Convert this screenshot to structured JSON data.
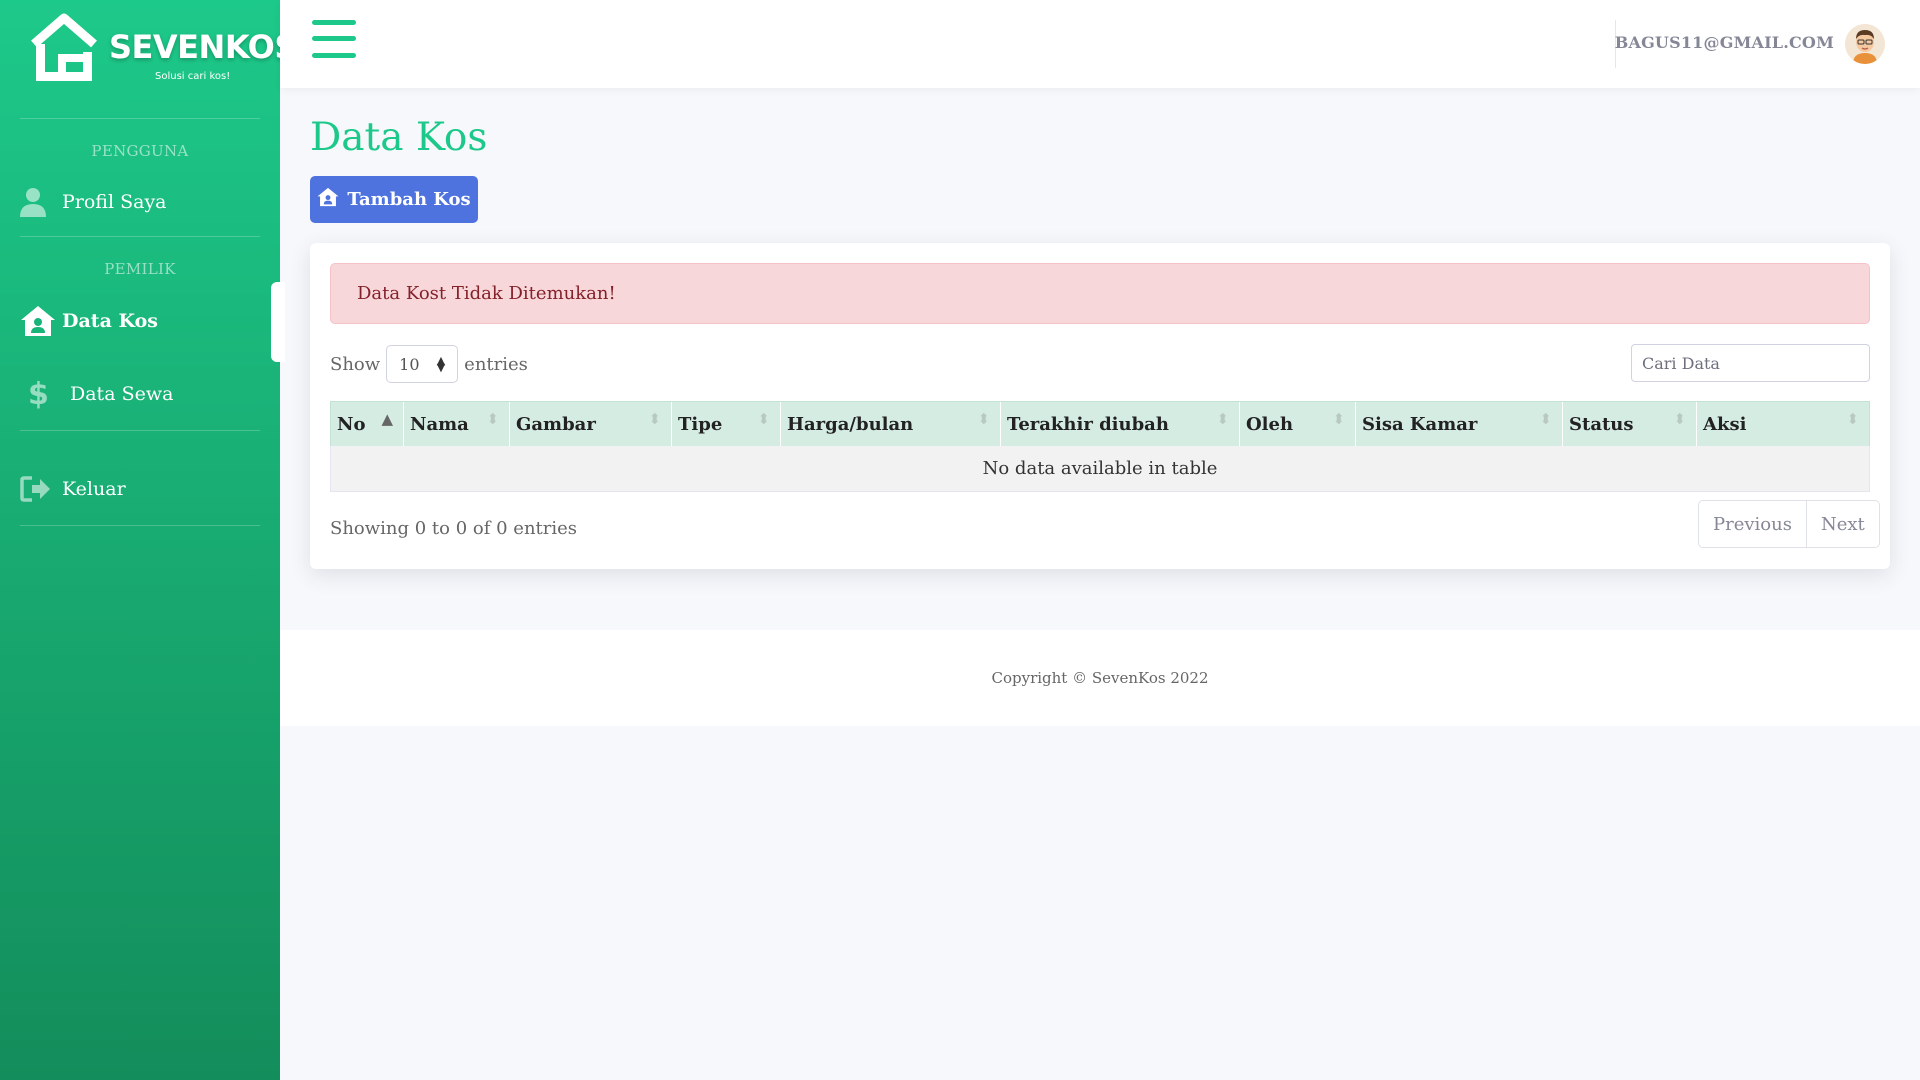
{
  "brand": {
    "name": "SEVENKOS",
    "tagline": "Solusi cari kos!"
  },
  "sidebar": {
    "sections": [
      {
        "heading": "PENGGUNA"
      },
      {
        "heading": "PEMILIK"
      }
    ],
    "items": [
      {
        "label": "Profil Saya",
        "icon": "user-icon"
      },
      {
        "label": "Data Kos",
        "icon": "house-user-icon",
        "active": true
      },
      {
        "label": "Data Sewa",
        "icon": "dollar-icon"
      },
      {
        "label": "Keluar",
        "icon": "sign-out-icon"
      }
    ]
  },
  "topbar": {
    "menu_icon": "hamburger-icon",
    "user_email": "BAGUS11@GMAIL.COM",
    "avatar_icon": "user-avatar"
  },
  "page": {
    "title": "Data Kos",
    "add_button": "Tambah Kos"
  },
  "alert": {
    "message": "Data Kost Tidak Ditemukan!",
    "color": "#f8d7da"
  },
  "table": {
    "length_label_before": "Show",
    "length_value": "10",
    "length_label_after": "entries",
    "search_placeholder": "Cari Data",
    "columns": [
      "No",
      "Nama",
      "Gambar",
      "Tipe",
      "Harga/bulan",
      "Terakhir diubah",
      "Oleh",
      "Sisa Kamar",
      "Status",
      "Aksi"
    ],
    "empty_message": "No data available in table",
    "info": "Showing 0 to 0 of 0 entries",
    "pagination": {
      "previous": "Previous",
      "next": "Next"
    }
  },
  "footer": {
    "copyright": "Copyright © SevenKos 2022"
  },
  "colors": {
    "accent": "#1dc98a",
    "primary_button": "#4e73df",
    "table_header": "#d5ece3"
  }
}
